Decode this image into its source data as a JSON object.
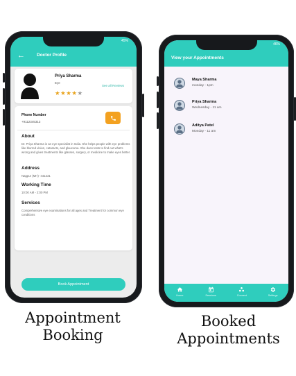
{
  "phone1": {
    "status_left": "",
    "status_right": "45%",
    "header_title": "Doctor Profile",
    "back_icon": "arrow-left-icon",
    "doctor": {
      "name": "Priya Sharma",
      "specialty": "Eye",
      "rating": 4,
      "rating_max": 5,
      "see_reviews": "See all Reviews"
    },
    "phone": {
      "label": "Phone Number",
      "value": "+9112345313"
    },
    "about": {
      "heading": "About",
      "text": "Dr. Priya Sharma is an eye specialist in India. She helps people with eye problems like blurred vision, cataracts, and glaucoma. She does tests to find out what's wrong and gives treatments like glasses, surgery, or medicine to make eyes better."
    },
    "address": {
      "heading": "Address",
      "text": "Nagpur (MH) -441231"
    },
    "working_time": {
      "heading": "Working Time",
      "text": "10:00 AM - 2:00 PM"
    },
    "services": {
      "heading": "Services",
      "text": "Comprehensive eye examinations for all ages and Treatment for common eye conditions"
    },
    "book_button": "Book Appointment",
    "caption_line1": "Appointment",
    "caption_line2": "Booking"
  },
  "phone2": {
    "status_right": "46%",
    "header_title": "View your Appointments",
    "appointments": [
      {
        "name": "Maya Sharma",
        "time": "monday  - 1pm"
      },
      {
        "name": "Priya Sharma",
        "time": "Wednesday  - 11 am"
      },
      {
        "name": "Aditya Patel",
        "time": "Monday  - 11 am"
      }
    ],
    "nav": [
      {
        "label": "Home",
        "icon": "home-icon"
      },
      {
        "label": "Sessions",
        "icon": "calendar-icon"
      },
      {
        "label": "Connect",
        "icon": "people-icon"
      },
      {
        "label": "Settings",
        "icon": "gear-icon"
      }
    ],
    "caption_line1": "Booked",
    "caption_line2": "Appointments"
  },
  "colors": {
    "teal": "#2fcdbd",
    "star": "#e8a21a",
    "call_button": "#f3a120",
    "phone_frame": "#17191c"
  }
}
